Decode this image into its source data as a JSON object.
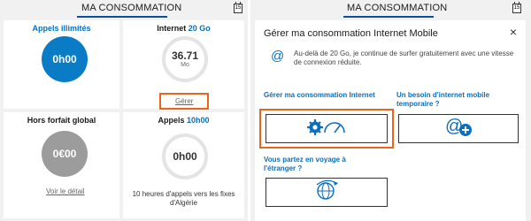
{
  "left": {
    "header_title": "MA CONSOMMATION",
    "calendar_day": "15",
    "cards": {
      "calls": {
        "title": "Appels illimités",
        "value": "0h00"
      },
      "internet": {
        "title_prefix": "Internet ",
        "title_accent": "20 Go",
        "value": "36.71",
        "unit": "Mo",
        "link": "Gérer"
      },
      "overage": {
        "title": "Hors forfait global",
        "value": "0€00",
        "link": "Voir le détail"
      },
      "calls10": {
        "title_prefix": "Appels ",
        "title_accent": "10h00",
        "value": "0h00",
        "note": "10 heures d'appels vers les fixes d'Algérie"
      }
    }
  },
  "right": {
    "header_title": "MA CONSOMMATION",
    "calendar_day": "15",
    "modal": {
      "title": "Gérer ma consommation Internet Mobile",
      "close": "×",
      "info_icon": "@",
      "info_text": "Au-delà de 20 Go, je continue de surfer gratuitement avec une vitesse de connexion réduite.",
      "option_manage": "Gérer ma consommation Internet",
      "option_temp": "Un besoin d'internet mobile temporaire ?",
      "option_travel": "Vous partez en voyage à l'étranger ?"
    }
  },
  "colors": {
    "accent": "#0a6fbf",
    "highlight": "#e8661e",
    "blue_fill": "#0a7cc5",
    "gray_fill": "#9c9c9c"
  },
  "icons": {
    "manage": "settings-gauge-icon",
    "temp": "at-plus-icon",
    "travel": "globe-plane-icon"
  }
}
